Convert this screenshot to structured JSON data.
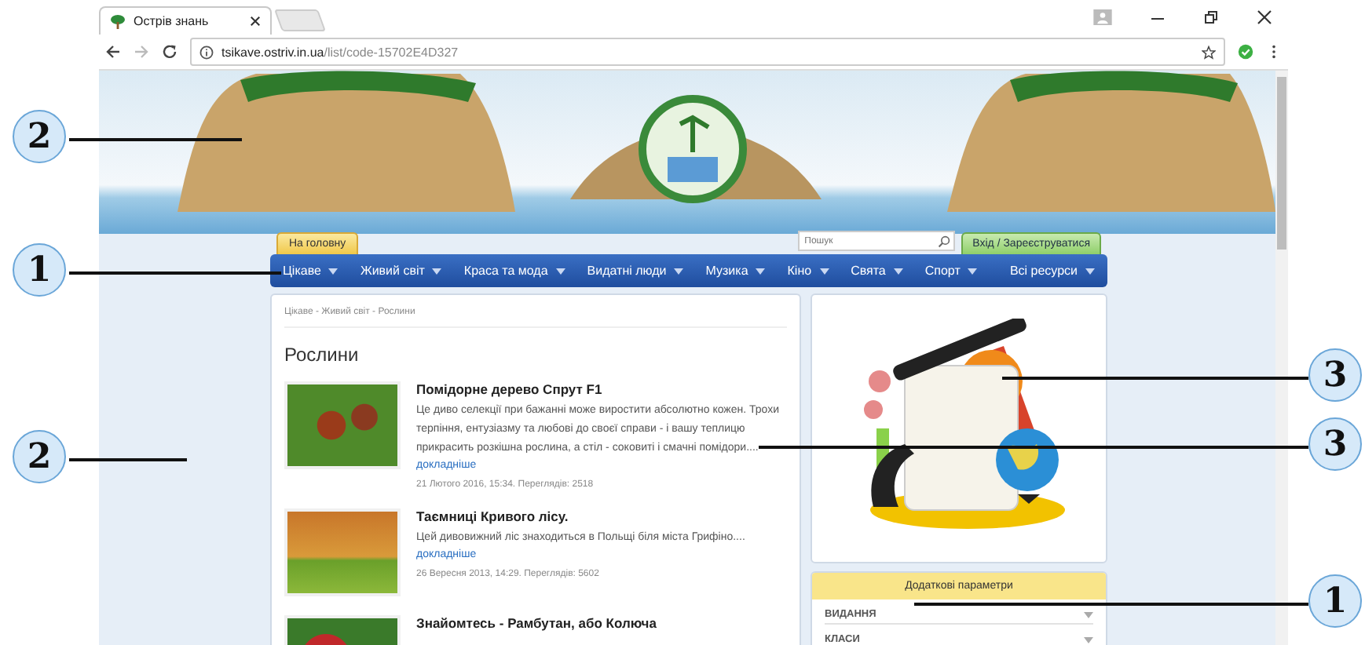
{
  "browser": {
    "tab_title": "Острів знань",
    "url_host": "tsikave.ostriv.in.ua",
    "url_path": "/list/code-15702E4D327"
  },
  "site": {
    "home_button": "На головну",
    "search_placeholder": "Пошук",
    "login_button": "Вхід / Зареєструватися",
    "nav": [
      {
        "label": "Цікаве"
      },
      {
        "label": "Живий світ"
      },
      {
        "label": "Краса та мода"
      },
      {
        "label": "Видатні люди"
      },
      {
        "label": "Музика"
      },
      {
        "label": "Кіно"
      },
      {
        "label": "Свята"
      },
      {
        "label": "Спорт"
      },
      {
        "label": "Всі ресурси"
      }
    ]
  },
  "breadcrumb": "Цікаве - Живий світ - Рослини",
  "heading": "Рослини",
  "articles": [
    {
      "title": "Помідорне дерево Спрут F1",
      "text": "Це диво селекції при бажанні може виростити абсолютно кожен. Трохи терпіння, ентузіазму та любові до своєї справи - і вашу теплицю прикрасить розкішна рослина, а стіл - соковиті і смачні помідори....",
      "more": "докладніше",
      "meta": "21 Лютого 2016, 15:34. Переглядів: 2518"
    },
    {
      "title": "Таємниці Кривого лісу.",
      "text": "Цей дивовижний ліс знаходиться в Польщі біля міста Грифіно....",
      "more": "докладніше",
      "meta": "26 Вересня 2013, 14:29. Переглядів: 5602"
    },
    {
      "title": "Знайомтесь - Рамбутан, або Колюча"
    }
  ],
  "sidebar": {
    "filters_title": "Додаткові параметри",
    "filters": [
      "ВИДАННЯ",
      "КЛАСИ"
    ]
  },
  "callouts": [
    {
      "number": "2"
    },
    {
      "number": "1"
    },
    {
      "number": "2"
    },
    {
      "number": "3"
    },
    {
      "number": "3"
    },
    {
      "number": "1"
    }
  ]
}
